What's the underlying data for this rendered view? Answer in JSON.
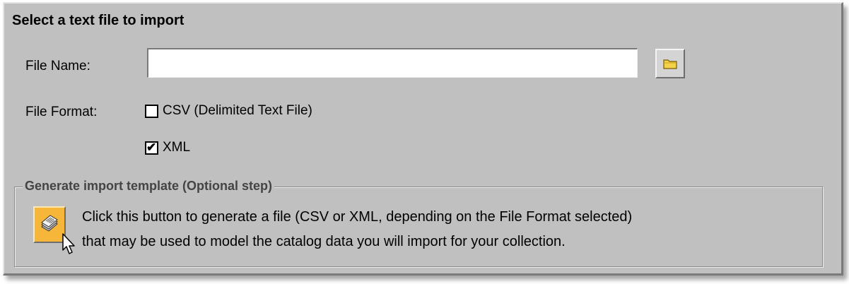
{
  "dialog": {
    "title": "Select a text file to import"
  },
  "file_name": {
    "label": "File Name:",
    "value": "",
    "placeholder": "",
    "browse_icon": "folder-icon"
  },
  "file_format": {
    "label": "File Format:",
    "options": [
      {
        "label": "CSV (Delimited Text File)",
        "checked": false
      },
      {
        "label": "XML",
        "checked": true
      }
    ],
    "check_glyph": "✔"
  },
  "template_group": {
    "legend": "Generate import template (Optional step)",
    "button_icon": "documents-icon",
    "description_line1": "Click this button to generate a file (CSV or XML, depending on the File Format selected)",
    "description_line2": "that may be used to model the catalog data you will import for your collection."
  },
  "colors": {
    "panel_bg": "#c0c0c0",
    "generate_button_bg": "#f5b63a",
    "folder_yellow": "#f2d34a"
  }
}
